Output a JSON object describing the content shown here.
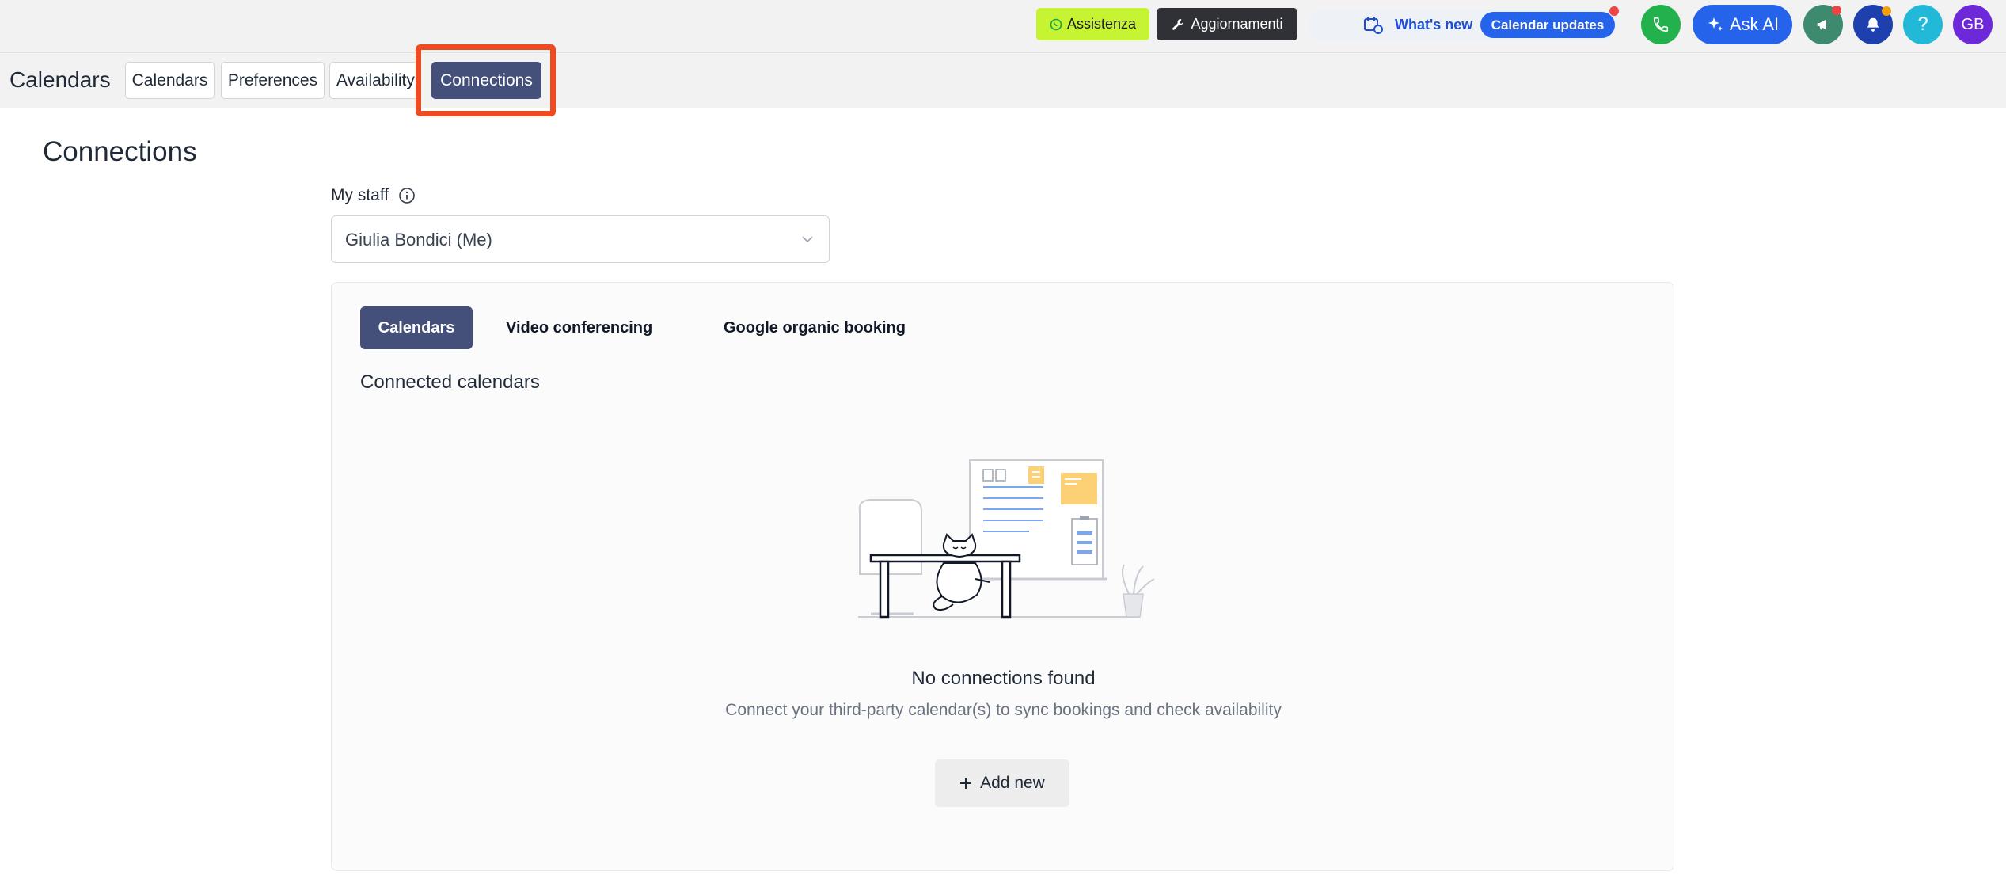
{
  "topbar": {
    "assist_label": "Assistenza",
    "updates_label": "Aggiornamenti",
    "whats_new_label": "What's new",
    "calendar_updates_label": "Calendar updates",
    "ask_ai_label": "Ask AI",
    "help_label": "?",
    "avatar_initials": "GB"
  },
  "subnav": {
    "title": "Calendars",
    "tabs": [
      {
        "label": "Calendars"
      },
      {
        "label": "Preferences"
      },
      {
        "label": "Availability"
      },
      {
        "label": "Connections"
      }
    ]
  },
  "page": {
    "title": "Connections",
    "staff_label": "My staff",
    "staff_value": "Giulia Bondici (Me)"
  },
  "panel": {
    "tabs": [
      {
        "label": "Calendars"
      },
      {
        "label": "Video conferencing"
      },
      {
        "label": "Google organic booking"
      }
    ],
    "section_title": "Connected calendars",
    "empty_title": "No connections found",
    "empty_description": "Connect your third-party calendar(s) to sync bookings and check availability",
    "add_button_label": "Add new"
  },
  "colors": {
    "accent": "#44507a",
    "highlight": "#f04a23",
    "assist_bg": "#c6f432",
    "primary_blue": "#2563eb"
  }
}
